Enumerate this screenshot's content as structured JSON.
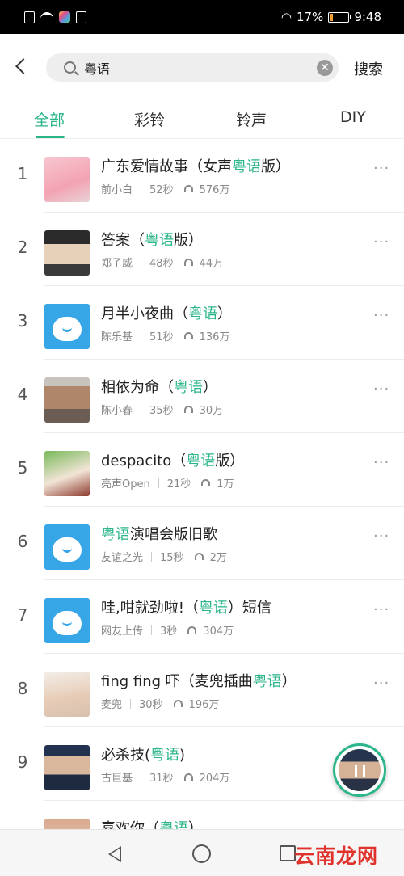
{
  "status_bar": {
    "battery": "17%",
    "time": "9:48"
  },
  "search": {
    "query": "粤语",
    "submit_label": "搜索"
  },
  "tabs": [
    {
      "label": "全部",
      "active": true
    },
    {
      "label": "彩铃",
      "active": false
    },
    {
      "label": "铃声",
      "active": false
    },
    {
      "label": "DIY",
      "active": false
    }
  ],
  "songs": [
    {
      "rank": "1",
      "title_pre": "广东爱情故事（女声",
      "title_hl": "粤语",
      "title_post": "版）",
      "artist": "前小白",
      "duration": "52秒",
      "plays": "576万"
    },
    {
      "rank": "2",
      "title_pre": "答案（",
      "title_hl": "粤语",
      "title_post": "版）",
      "artist": "郑子威",
      "duration": "48秒",
      "plays": "44万"
    },
    {
      "rank": "3",
      "title_pre": "月半小夜曲（",
      "title_hl": "粤语",
      "title_post": "）",
      "artist": "陈乐基",
      "duration": "51秒",
      "plays": "136万"
    },
    {
      "rank": "4",
      "title_pre": "相依为命（",
      "title_hl": "粤语",
      "title_post": "）",
      "artist": "陈小春",
      "duration": "35秒",
      "plays": "30万"
    },
    {
      "rank": "5",
      "title_pre": "despacito（",
      "title_hl": "粤语",
      "title_post": "版）",
      "artist": "亮声Open",
      "duration": "21秒",
      "plays": "1万"
    },
    {
      "rank": "6",
      "title_pre": "",
      "title_hl": "粤语",
      "title_post": "演唱会版旧歌",
      "artist": "友谊之光",
      "duration": "15秒",
      "plays": "2万"
    },
    {
      "rank": "7",
      "title_pre": "哇,咁就劲啦!（",
      "title_hl": "粤语",
      "title_post": "）短信",
      "artist": "网友上传",
      "duration": "3秒",
      "plays": "304万"
    },
    {
      "rank": "8",
      "title_pre": "fing fing 吓（麦兜插曲",
      "title_hl": "粤语",
      "title_post": "）",
      "artist": "麦兜",
      "duration": "30秒",
      "plays": "196万"
    },
    {
      "rank": "9",
      "title_pre": "必杀技(",
      "title_hl": "粤语",
      "title_post": ")",
      "artist": "古巨基",
      "duration": "31秒",
      "plays": "204万"
    },
    {
      "rank": "",
      "title_pre": "喜欢你（",
      "title_hl": "粤语",
      "title_post": "）",
      "artist": "",
      "duration": "",
      "plays": ""
    }
  ],
  "more_label": "···",
  "watermark": "云南龙网"
}
